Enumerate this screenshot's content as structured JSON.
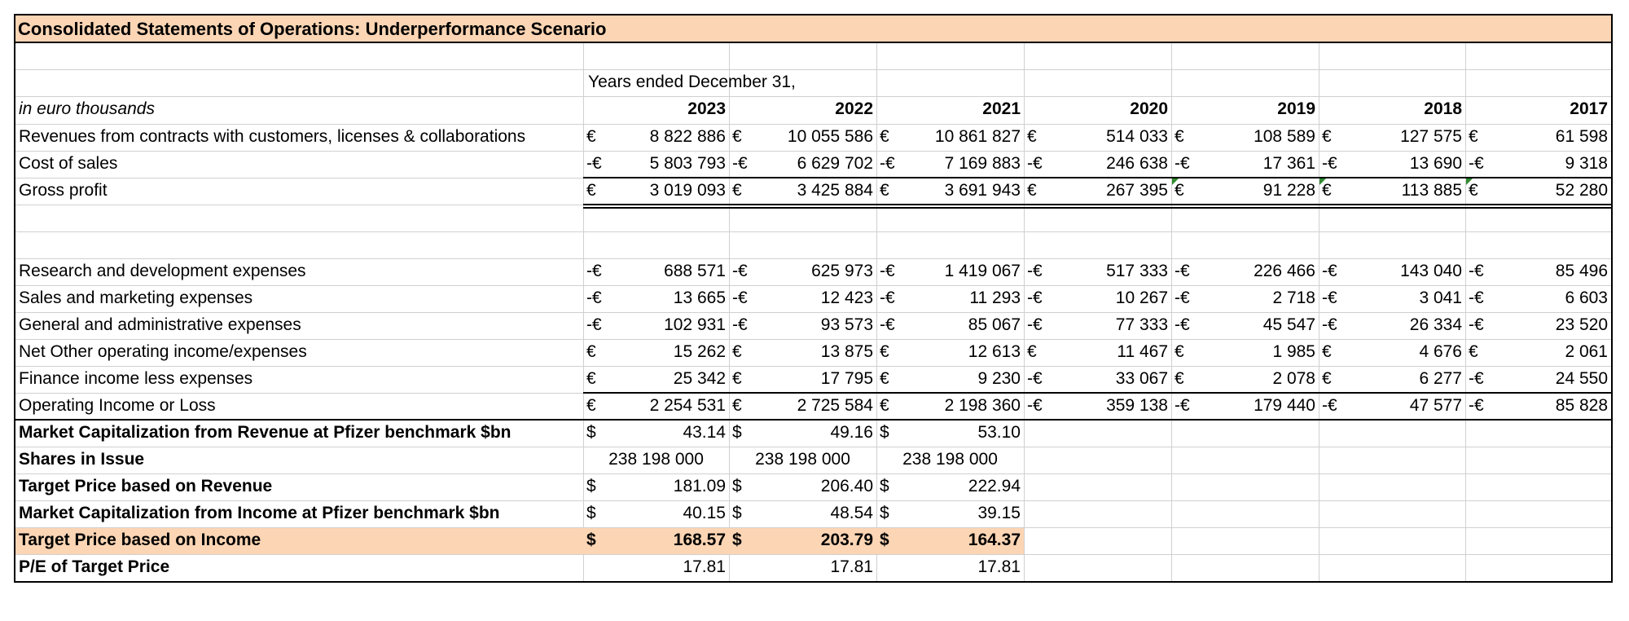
{
  "sheet": {
    "title": "Consolidated Statements of Operations: Underperformance Scenario",
    "years_caption": "Years ended December 31,",
    "units_caption": "in euro thousands",
    "years": [
      "2023",
      "2022",
      "2021",
      "2020",
      "2019",
      "2018",
      "2017"
    ],
    "accent_color": "#fcd5b4",
    "rows": [
      {
        "label": "Revenues from contracts with customers, licenses & collaborations",
        "cells": [
          [
            "€",
            "8 822 886"
          ],
          [
            "€",
            "10 055 586"
          ],
          [
            "€",
            "10 861 827"
          ],
          [
            "€",
            "514 033"
          ],
          [
            "€",
            "108 589"
          ],
          [
            "€",
            "127 575"
          ],
          [
            "€",
            "61 598"
          ]
        ]
      },
      {
        "label": "Cost of sales",
        "cells": [
          [
            "-€",
            "5 803 793"
          ],
          [
            "-€",
            "6 629 702"
          ],
          [
            "-€",
            "7 169 883"
          ],
          [
            "-€",
            "246 638"
          ],
          [
            "-€",
            "17 361"
          ],
          [
            "-€",
            "13 690"
          ],
          [
            "-€",
            "9 318"
          ]
        ]
      },
      {
        "label": "Gross profit",
        "cells": [
          [
            "€",
            "3 019 093"
          ],
          [
            "€",
            "3 425 884"
          ],
          [
            "€",
            "3 691 943"
          ],
          [
            "€",
            "267 395"
          ],
          [
            "€",
            "91 228"
          ],
          [
            "€",
            "113 885"
          ],
          [
            "€",
            "52 280"
          ]
        ]
      },
      {
        "label": "",
        "cells": []
      },
      {
        "label": "",
        "cells": []
      },
      {
        "label": "Research and development expenses",
        "cells": [
          [
            "-€",
            "688 571"
          ],
          [
            "-€",
            "625 973"
          ],
          [
            "-€",
            "1 419 067"
          ],
          [
            "-€",
            "517 333"
          ],
          [
            "-€",
            "226 466"
          ],
          [
            "-€",
            "143 040"
          ],
          [
            "-€",
            "85 496"
          ]
        ]
      },
      {
        "label": "Sales and marketing expenses",
        "cells": [
          [
            "-€",
            "13 665"
          ],
          [
            "-€",
            "12 423"
          ],
          [
            "-€",
            "11 293"
          ],
          [
            "-€",
            "10 267"
          ],
          [
            "-€",
            "2 718"
          ],
          [
            "-€",
            "3 041"
          ],
          [
            "-€",
            "6 603"
          ]
        ]
      },
      {
        "label": "General and administrative expenses",
        "cells": [
          [
            "-€",
            "102 931"
          ],
          [
            "-€",
            "93 573"
          ],
          [
            "-€",
            "85 067"
          ],
          [
            "-€",
            "77 333"
          ],
          [
            "-€",
            "45 547"
          ],
          [
            "-€",
            "26 334"
          ],
          [
            "-€",
            "23 520"
          ]
        ]
      },
      {
        "label": "Net Other operating income/expenses",
        "cells": [
          [
            "€",
            "15 262"
          ],
          [
            "€",
            "13 875"
          ],
          [
            "€",
            "12 613"
          ],
          [
            "€",
            "11 467"
          ],
          [
            "€",
            "1 985"
          ],
          [
            "€",
            "4 676"
          ],
          [
            "€",
            "2 061"
          ]
        ]
      },
      {
        "label": "Finance income less expenses",
        "cells": [
          [
            "€",
            "25 342"
          ],
          [
            "€",
            "17 795"
          ],
          [
            "€",
            "9 230"
          ],
          [
            "-€",
            "33 067"
          ],
          [
            "€",
            "2 078"
          ],
          [
            "€",
            "6 277"
          ],
          [
            "-€",
            "24 550"
          ]
        ]
      },
      {
        "label": "Operating Income or Loss",
        "cells": [
          [
            "€",
            "2 254 531"
          ],
          [
            "€",
            "2 725 584"
          ],
          [
            "€",
            "2 198 360"
          ],
          [
            "-€",
            "359 138"
          ],
          [
            "-€",
            "179 440"
          ],
          [
            "-€",
            "47 577"
          ],
          [
            "-€",
            "85 828"
          ]
        ]
      },
      {
        "label": "Market Capitalization from Revenue at Pfizer benchmark $bn",
        "bold": true,
        "cells": [
          [
            "$",
            "43.14"
          ],
          [
            "$",
            "49.16"
          ],
          [
            "$",
            "53.10"
          ]
        ]
      },
      {
        "label": "Shares in Issue",
        "bold": true,
        "centered": true,
        "cells": [
          [
            "",
            "238 198 000"
          ],
          [
            "",
            "238 198 000"
          ],
          [
            "",
            "238 198 000"
          ]
        ]
      },
      {
        "label": "Target Price based on Revenue",
        "bold": true,
        "cells": [
          [
            "$",
            "181.09"
          ],
          [
            "$",
            "206.40"
          ],
          [
            "$",
            "222.94"
          ]
        ]
      },
      {
        "label": "Market Capitalization from Income at Pfizer benchmark $bn",
        "bold": true,
        "cells": [
          [
            "$",
            "40.15"
          ],
          [
            "$",
            "48.54"
          ],
          [
            "$",
            "39.15"
          ]
        ]
      },
      {
        "label": "Target Price based on Income",
        "bold": true,
        "highlight": true,
        "bold_values": true,
        "cells": [
          [
            "$",
            "168.57"
          ],
          [
            "$",
            "203.79"
          ],
          [
            "$",
            "164.37"
          ]
        ]
      },
      {
        "label": "P/E of Target Price",
        "bold": true,
        "cells": [
          [
            "",
            "17.81"
          ],
          [
            "",
            "17.81"
          ],
          [
            "",
            "17.81"
          ]
        ]
      }
    ]
  }
}
